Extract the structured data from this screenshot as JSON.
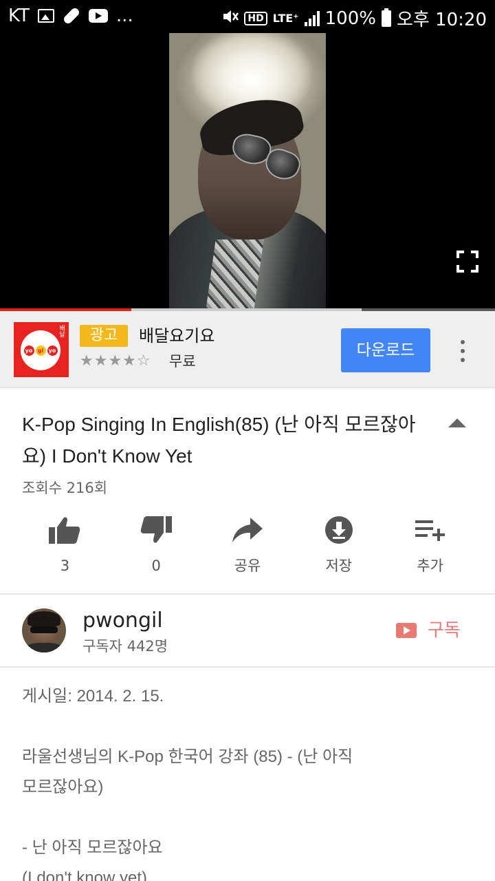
{
  "status_bar": {
    "carrier": "KT",
    "more": "...",
    "network": "LTE⁺",
    "hd": "HD",
    "battery": "100%",
    "time": "오후 10:20"
  },
  "player": {
    "progress_played": 0.265,
    "progress_buffered": 0.73
  },
  "ad": {
    "badge": "광고",
    "app_name": "배달요기요",
    "rating": 4.5,
    "stars_display": "★★★★☆",
    "price": "무료",
    "download_label": "다운로드",
    "logo_syllables": [
      "yo",
      "gi",
      "yo"
    ],
    "logo_tag": "배달"
  },
  "video": {
    "title": "K-Pop Singing In English(85) (난 아직 모르잖아요) I Don't Know Yet",
    "views": "조회수 216회"
  },
  "actions": [
    {
      "icon": "thumbs-up-icon",
      "label": "3"
    },
    {
      "icon": "thumbs-down-icon",
      "label": "0"
    },
    {
      "icon": "share-icon",
      "label": "공유"
    },
    {
      "icon": "download-icon",
      "label": "저장"
    },
    {
      "icon": "add-to-playlist-icon",
      "label": "추가"
    }
  ],
  "channel": {
    "name": "pwongil",
    "subscribers": "구독자 442명",
    "subscribe_label": "구독"
  },
  "description": {
    "published": "게시일: 2014. 2. 15.",
    "line1": "라울선생님의 K-Pop 한국어 강좌 (85) - (난 아직",
    "line2": "모르잖아요)",
    "line3": "- 난 아직 모르잖아요",
    "line4": "(I don't know yet)"
  },
  "colors": {
    "accent_red": "#e62117",
    "download_blue": "#4285f4",
    "ad_badge_yellow": "#f5b81b",
    "subscribe_red": "#e87a73"
  }
}
